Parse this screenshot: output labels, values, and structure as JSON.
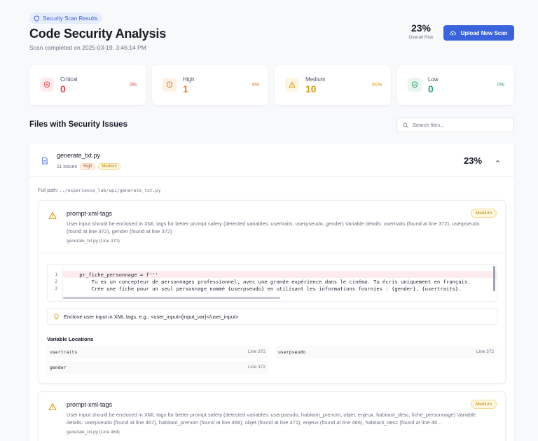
{
  "header": {
    "badge": "Security Scan Results",
    "title": "Code Security Analysis",
    "subtitle": "Scan completed on 2025-03-19, 3:46:14 PM",
    "overall_risk_value": "23%",
    "overall_risk_label": "Overall Risk",
    "upload_button": "Upload New Scan"
  },
  "stats": [
    {
      "label": "Critical",
      "count": "0",
      "percent": "0%",
      "color": "#e0444e"
    },
    {
      "label": "High",
      "count": "1",
      "percent": "9%",
      "color": "#e37b24"
    },
    {
      "label": "Medium",
      "count": "10",
      "percent": "91%",
      "color": "#d79a10"
    },
    {
      "label": "Low",
      "count": "0",
      "percent": "0%",
      "color": "#2f9e6b"
    }
  ],
  "files_section": {
    "title": "Files with Security Issues",
    "search_placeholder": "Search files..."
  },
  "file": {
    "name": "generate_txt.py",
    "issues_count": "11 issues",
    "tags": [
      "High",
      "Medium"
    ],
    "risk": "23%",
    "full_path_label": "Full path:",
    "full_path": "../experience_lab/api/generate_txt.py"
  },
  "issues": [
    {
      "name": "prompt-xml-tags",
      "severity": "Medium",
      "description": "User input should be enclosed in XML tags for better prompt safety (detected variables: usertraits, userpseudo, gender) Variable details: usertraits (found at line 372), userpseudo (found at line 372), gender (found at line 372)",
      "location": "generate_txt.py (Line 370)",
      "code_lines": [
        {
          "num": "1",
          "text": "    pr_fiche_personnage = f'''"
        },
        {
          "num": "2",
          "text": "        Tu es un concepteur de personnages professionnel, avec une grande expérience dans le cinéma. Tu écris uniquement en français."
        },
        {
          "num": "3",
          "text": "        Crée une fiche pour un seul personnage nommé {userpseudo} en utilisant les informations fournies : {gender}, {usertraits}."
        }
      ],
      "recommendation": "Enclose user input in XML tags, e.g., <user_input>{input_var}</user_input>",
      "variable_locations_title": "Variable Locations",
      "variables": [
        {
          "name": "usertraits",
          "line": "Line 372"
        },
        {
          "name": "userpseudo",
          "line": "Line 372"
        },
        {
          "name": "gender",
          "line": "Line 372"
        }
      ]
    },
    {
      "name": "prompt-xml-tags",
      "severity": "Medium",
      "description": "User input should be enclosed in XML tags for better prompt safety (detected variables: userpseudo, habitant_prenom, objet, enjeux, habitant_desc, fiche_personnage) Variable details: userpseudo (found at line 467), habitant_prenom (found at line 468), objet (found at line 471), enjeux (found at line 466), habitant_desc (found at line 46…",
      "location": "generate_txt.py (Line 464)"
    }
  ]
}
